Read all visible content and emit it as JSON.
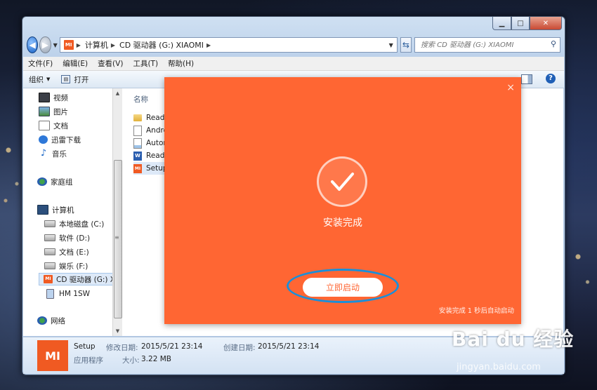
{
  "explorer": {
    "address": {
      "crumbs": [
        "计算机",
        "CD 驱动器 (G:) XIAOMI"
      ],
      "search_placeholder": "搜索 CD 驱动器 (G:) XIAOMI"
    },
    "menu": [
      "文件(F)",
      "编辑(E)",
      "查看(V)",
      "工具(T)",
      "帮助(H)"
    ],
    "toolbar": {
      "organize": "组织",
      "open": "打开"
    },
    "nav": {
      "libraries": [
        "视频",
        "图片",
        "文档",
        "迅雷下载",
        "音乐"
      ],
      "homegroup": "家庭组",
      "computer": "计算机",
      "drives": [
        "本地磁盘 (C:)",
        "软件 (D:)",
        "文档 (E:)",
        "娱乐 (F:)",
        "CD 驱动器 (G:) X",
        "HM 1SW"
      ],
      "network": "网络"
    },
    "content": {
      "column_name": "名称",
      "files": [
        "Read",
        "Andro",
        "Autor",
        "Read",
        "Setup"
      ]
    },
    "details": {
      "icon_text": "MI",
      "name": "Setup",
      "type": "应用程序",
      "modified_label": "修改日期:",
      "modified_value": "2015/5/21 23:14",
      "created_label": "创建日期:",
      "created_value": "2015/5/21 23:14",
      "size_label": "大小:",
      "size_value": "3.22 MB"
    }
  },
  "installer": {
    "title": "安装完成",
    "start_button": "立即启动",
    "countdown": "安装完成 1 秒后自动启动",
    "close_glyph": "×",
    "accent_color": "#ff6633"
  },
  "watermark": {
    "brand": "Bai du 经验",
    "sub": "jingyan.baidu.com"
  }
}
